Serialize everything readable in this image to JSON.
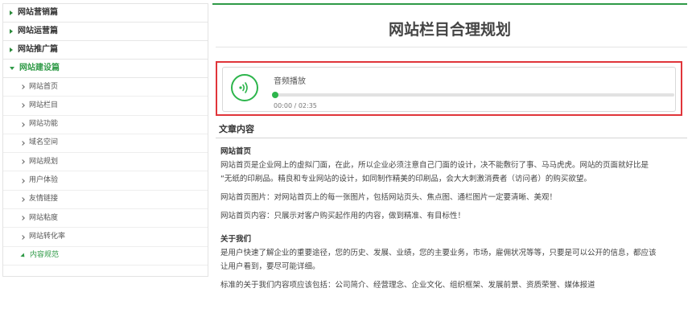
{
  "sidebar": {
    "categories": [
      {
        "label": "网站营销篇"
      },
      {
        "label": "网站运营篇"
      },
      {
        "label": "网站推广篇"
      },
      {
        "label": "网站建设篇"
      }
    ],
    "sub_items": [
      {
        "label": "网站首页"
      },
      {
        "label": "网站栏目"
      },
      {
        "label": "网站功能"
      },
      {
        "label": "域名空间"
      },
      {
        "label": "网站规划"
      },
      {
        "label": "用户体验"
      },
      {
        "label": "友情链接"
      },
      {
        "label": "网站粘度"
      },
      {
        "label": "网站转化率"
      },
      {
        "label": "内容规范"
      }
    ]
  },
  "main": {
    "title": "网站栏目合理规划",
    "audio": {
      "label": "音频播放",
      "current_time": "00:00",
      "total_time": "02:35",
      "time_display": "00:00 / 02:35",
      "progress": 0.0,
      "accent_color": "#2db54c",
      "highlight_border": "#e0353a"
    },
    "section_title": "文章内容",
    "article": {
      "h1": "网站首页",
      "p1": "网站首页是企业网上的虚拟门面，在此，所以企业必须注意自己门面的设计，决不能敷衍了事、马马虎虎。网站的页面就好比是",
      "p1b": "“无纸的印刷品。精良和专业网站的设计，如同制作精美的印刷品，会大大刺激消费者（访问者）的购买欲望。",
      "p2": "网站首页图片：对网站首页上的每一张图片，包括网站页头、焦点图、通栏图片一定要清晰、美观！",
      "p3": "网站首页内容：只展示对客户购买起作用的内容，做到精准、有目标性！",
      "h2": "关于我们",
      "p4": "是用户快速了解企业的重要途径，您的历史、发展、业绩，您的主要业务，市场，雇佣状况等等，只要是可以公开的信息，都应该",
      "p4b": "让用户看到，要尽可能详细。",
      "p5": "标准的关于我们内容项应该包括：公司简介、经营理念、企业文化、组织框架、发展前景、资质荣誉、媒体报道"
    }
  }
}
